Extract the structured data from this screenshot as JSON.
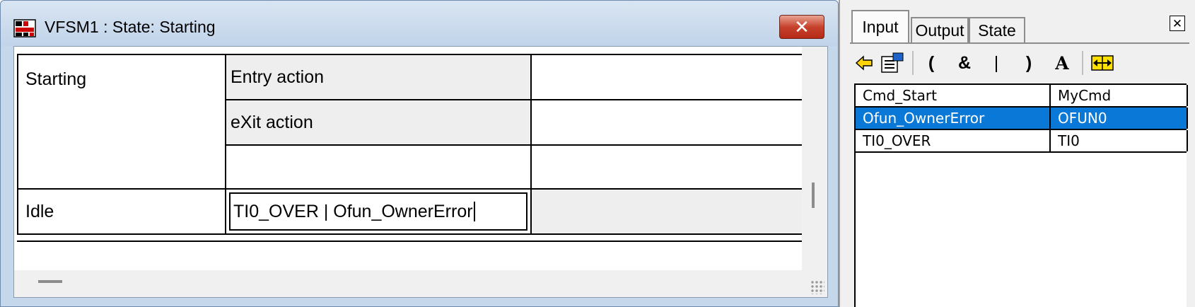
{
  "window": {
    "title": "VFSM1 : State: Starting",
    "close_label": "✕",
    "icon": "vfsm-app-icon"
  },
  "grid": {
    "state_name": "Starting",
    "entry_action_label": "Entry action",
    "exit_action_label": "eXit action",
    "transition_target": "Idle",
    "transition_condition": "TI0_OVER | Ofun_OwnerError"
  },
  "panel": {
    "tabs": [
      {
        "label": "Input",
        "active": true
      },
      {
        "label": "Output",
        "active": false
      },
      {
        "label": "State",
        "active": false
      }
    ],
    "close_label": "✕",
    "toolbar": [
      {
        "name": "insert-arrow-icon",
        "glyph": "⇦"
      },
      {
        "name": "properties-icon",
        "glyph": "▤"
      },
      {
        "name": "open-paren-button",
        "glyph": "("
      },
      {
        "name": "and-button",
        "glyph": "&"
      },
      {
        "name": "or-button",
        "glyph": "|"
      },
      {
        "name": "close-paren-button",
        "glyph": ")"
      },
      {
        "name": "font-button",
        "glyph": "A"
      },
      {
        "name": "resize-columns-icon",
        "glyph": "⇔"
      }
    ],
    "variables": [
      {
        "name": "Cmd_Start",
        "value": "MyCmd",
        "selected": false
      },
      {
        "name": "Ofun_OwnerError",
        "value": "OFUN0",
        "selected": true
      },
      {
        "name": "TI0_OVER",
        "value": "TI0",
        "selected": false
      }
    ]
  },
  "colors": {
    "selection": "#0a78d7",
    "title_gradient_top": "#d9e5f2",
    "close_button": "#c7432d"
  }
}
